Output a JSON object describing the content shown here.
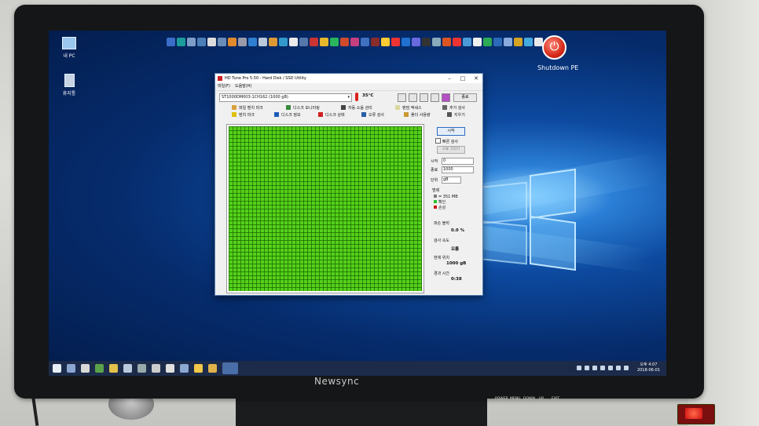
{
  "desktop": {
    "icons": [
      {
        "label": "내 PC",
        "icon": "computer-icon"
      },
      {
        "label": "휴지통",
        "icon": "recycle-bin-icon"
      }
    ],
    "shutdown_label": "Shutdown PE"
  },
  "window": {
    "title": "HD Tune Pro 5.50 - Hard Disk / SSD Utility",
    "menu": [
      "파일(F)",
      "도움말(H)"
    ],
    "drive": "ST1000DM003-1CH162 (1000 gB)",
    "temperature": "35°C",
    "exit_label": "종료",
    "tabs_row1": [
      "파일 벤치 마크",
      "디스크 모니터링",
      "자동 소음 관리",
      "랜덤 액세스",
      "추가 검사"
    ],
    "tabs_row2": [
      "벤치 마크",
      "디스크 정보",
      "디스크 상태",
      "오류 검사",
      "폴더 사용량",
      "지우기"
    ],
    "side": {
      "start_label": "시작",
      "quick_scan_label": "빠른 검사",
      "disabled_btn": "오류 그리기",
      "start_field_label": "시작",
      "start_value": "0",
      "end_field_label": "종료",
      "end_value": "1000",
      "unit_label": "단위",
      "unit_value": "gB",
      "legend_title": "범례",
      "legend": [
        {
          "label": "= 351 MB",
          "color": "#7a7a7a"
        },
        {
          "label": "확인",
          "color": "#2bbf2b"
        },
        {
          "label": "손상",
          "color": "#d01010"
        }
      ],
      "damaged_label": "파손 블럭",
      "damaged_value": "0.0 %",
      "speed_label": "검사 속도",
      "speed_value": "오름",
      "position_label": "현재 위치",
      "position_value": "1000 gB",
      "elapsed_label": "경과 시간",
      "elapsed_value": "0:38"
    }
  },
  "taskbar": {
    "clock_time": "오후 4:07",
    "clock_date": "2018-06-01"
  },
  "monitor": {
    "brand": "Newsync",
    "controls": [
      "POWER",
      "MENU",
      "DOWN",
      "UP",
      "EXIT"
    ]
  },
  "colors": {
    "scan_ok": "#55d11a",
    "desktop_blue": "#0d4aa0",
    "taskbar": "#1c2b4a"
  }
}
